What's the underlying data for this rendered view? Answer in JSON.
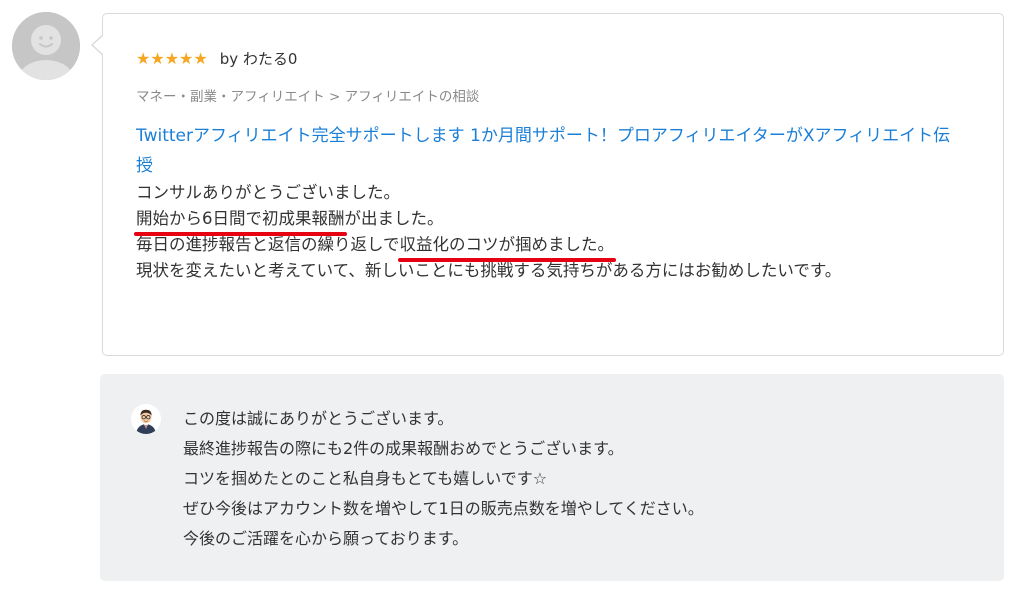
{
  "reviewer": {
    "avatar_icon": "default-user-avatar-icon",
    "rating_stars": "★★★★★",
    "rating_value": 5,
    "by_label": "by わたる0"
  },
  "review": {
    "category": "マネー・副業・アフィリエイト > アフィリエイトの相談",
    "service_title": "Twitterアフィリエイト完全サポートします 1か月間サポート！プロアフィリエイターがXアフィリエイト伝授",
    "line1": "コンサルありがとうございました。",
    "line2_marked": "開始から6日間で初成果報酬",
    "line2_rest": "が出ました。",
    "line3_start": "毎日の進捗報告と返信の繰り返しで",
    "line3_marked": "収益化のコツが掴めました。",
    "line4": "現状を変えたいと考えていて、新しいことにも挑戦する気持ちがある方にはお勧めしたいです。"
  },
  "reply": {
    "seller_avatar_icon": "seller-avatar-icon",
    "lines": [
      "この度は誠にありがとうございます。",
      "最終進捗報告の際にも2件の成果報酬おめでとうございます。",
      "コツを掴めたとのこと私自身もとても嬉しいです☆",
      "ぜひ今後はアカウント数を増やして1日の販売点数を増やしてください。",
      "今後のご活躍を心から願っております。"
    ]
  },
  "colors": {
    "star": "#f5a623",
    "link": "#1a7fd6",
    "underline_marker": "#e60012",
    "reply_bg": "#eef0f2"
  }
}
